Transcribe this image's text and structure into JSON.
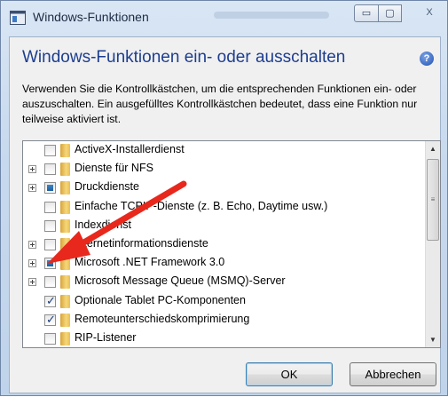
{
  "window": {
    "title": "Windows-Funktionen"
  },
  "title_controls": {
    "minimize": "▭",
    "maximize": "▢",
    "close": "X"
  },
  "heading": "Windows-Funktionen ein- oder ausschalten",
  "help_icon_glyph": "?",
  "description": "Verwenden Sie die Kontrollkästchen, um die entsprechenden Funktionen ein- oder auszuschalten. Ein ausgefülltes Kontrollkästchen bedeutet, dass eine Funktion nur teilweise aktiviert ist.",
  "features": [
    {
      "label": "ActiveX-Installerdienst",
      "state": "unchecked",
      "expandable": false
    },
    {
      "label": "Dienste für NFS",
      "state": "unchecked",
      "expandable": true
    },
    {
      "label": "Druckdienste",
      "state": "partial",
      "expandable": true
    },
    {
      "label": "Einfache TCPIP-Dienste (z. B. Echo, Daytime usw.)",
      "state": "unchecked",
      "expandable": false
    },
    {
      "label": "Indexdienst",
      "state": "unchecked",
      "expandable": false
    },
    {
      "label": "Internetinformationsdienste",
      "state": "unchecked",
      "expandable": true
    },
    {
      "label": "Microsoft .NET Framework 3.0",
      "state": "partial",
      "expandable": true
    },
    {
      "label": "Microsoft Message Queue (MSMQ)-Server",
      "state": "unchecked",
      "expandable": true
    },
    {
      "label": "Optionale Tablet PC-Komponenten",
      "state": "checked",
      "expandable": false
    },
    {
      "label": "Remoteunterschiedskomprimierung",
      "state": "checked",
      "expandable": false
    },
    {
      "label": "RIP-Listener",
      "state": "unchecked",
      "expandable": false
    }
  ],
  "scrollbar": {
    "up": "▲",
    "down": "▼",
    "grip": "≡"
  },
  "buttons": {
    "ok": "OK",
    "cancel": "Abbrechen"
  },
  "colors": {
    "heading": "#1d3e8f",
    "arrow": "#e8281c",
    "partial_fill": "#2a6fb0"
  }
}
